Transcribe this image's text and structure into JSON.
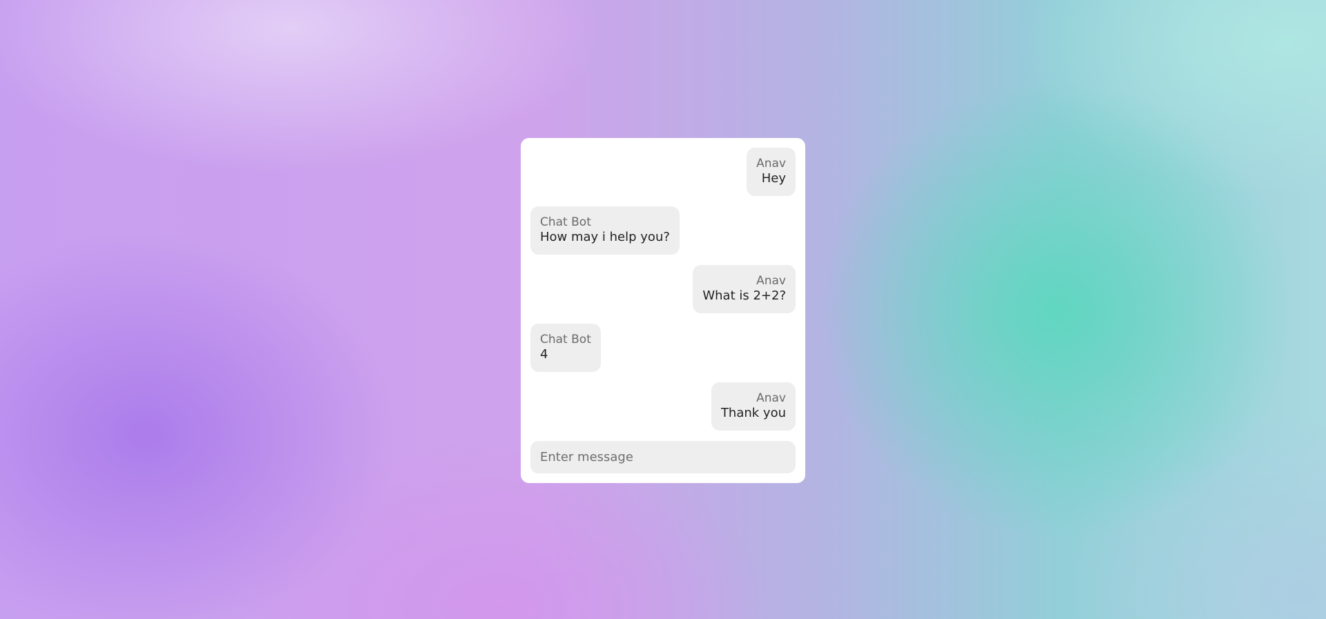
{
  "chat": {
    "messages": [
      {
        "role": "user",
        "sender": "Anav",
        "text": "Hey"
      },
      {
        "role": "bot",
        "sender": "Chat Bot",
        "text": "How may i help you?"
      },
      {
        "role": "user",
        "sender": "Anav",
        "text": "What is 2+2?"
      },
      {
        "role": "bot",
        "sender": "Chat Bot",
        "text": "4"
      },
      {
        "role": "user",
        "sender": "Anav",
        "text": "Thank you"
      }
    ],
    "input": {
      "placeholder": "Enter message",
      "value": ""
    }
  },
  "colors": {
    "card_background": "#ffffff",
    "bubble_background": "#eeeeee",
    "sender_text": "#6a6a6a",
    "message_text": "#222222"
  }
}
